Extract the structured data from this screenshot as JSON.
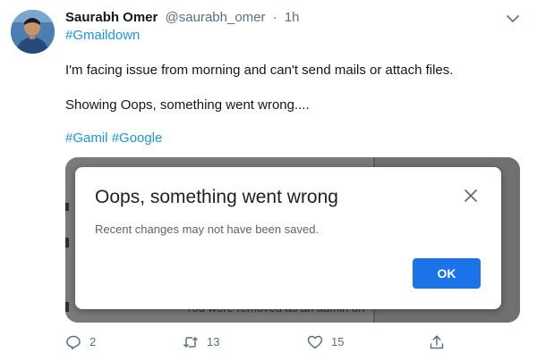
{
  "tweet": {
    "author_name": "Saurabh Omer",
    "author_handle": "@saurabh_omer",
    "separator": "·",
    "time": "1h",
    "hashtag_top": "#Gmaildown",
    "text_line1": "I'm facing issue from morning and can't send mails or attach files.",
    "text_line2": "Showing Oops, something went wrong....",
    "hashtags": [
      "#Gamil",
      "#Google"
    ]
  },
  "screenshot": {
    "background_text": "You were removed as an admin on",
    "dialog": {
      "title": "Oops, something went wrong",
      "message": "Recent changes may not have been saved.",
      "ok_label": "OK"
    }
  },
  "actions": {
    "reply_count": "2",
    "retweet_count": "13",
    "like_count": "15"
  },
  "colors": {
    "link": "#1b95e0",
    "ok_button": "#1a73e8",
    "muted": "#5b7083"
  },
  "icons": [
    "chevron-down-icon",
    "close-icon",
    "reply-icon",
    "retweet-icon",
    "like-icon",
    "share-icon"
  ]
}
